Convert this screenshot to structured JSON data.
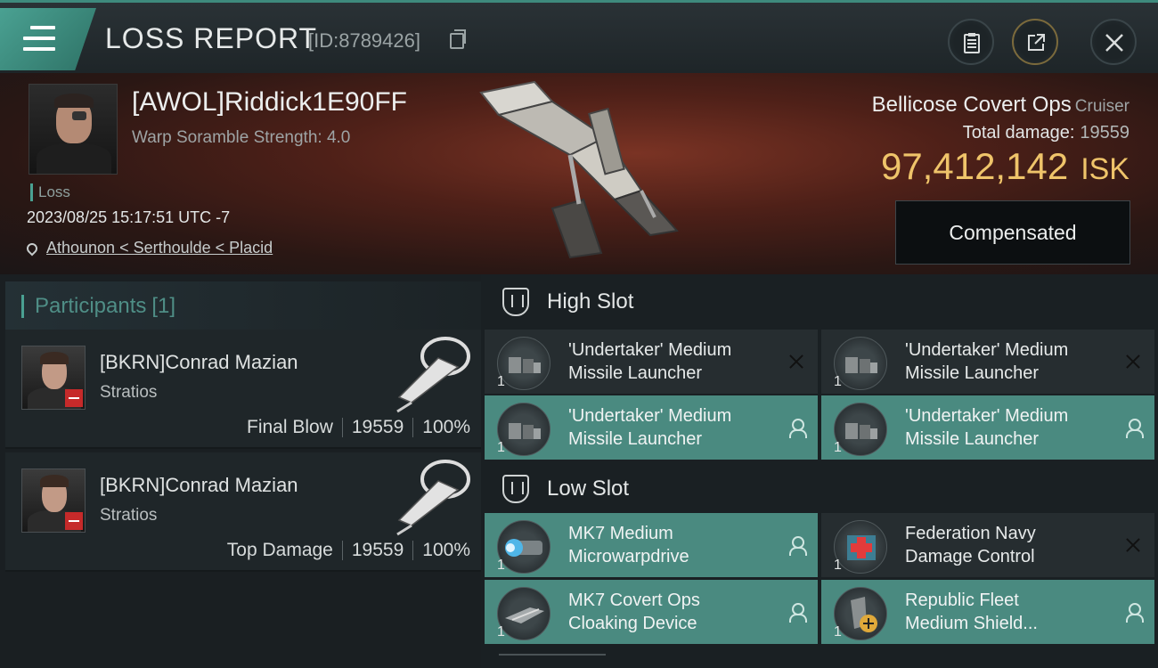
{
  "header": {
    "title": "LOSS REPORT",
    "report_id": "[ID:8789426]"
  },
  "victim": {
    "name": "[AWOL]Riddick1E90FF",
    "scramble": "Warp Soramble Strength: 4.0",
    "tag": "Loss",
    "datetime": "2023/08/25 15:17:51 UTC -7",
    "location": "Athounon < Serthoulde < Placid",
    "ship_name": "Bellicose Covert Ops",
    "ship_class": "Cruiser",
    "total_damage_label": "Total damage:",
    "total_damage": "19559",
    "isk_value": "97,412,142",
    "isk_unit": "ISK",
    "compensated_label": "Compensated"
  },
  "participants": {
    "label": "Participants",
    "count": "[1]",
    "items": [
      {
        "name": "[BKRN]Conrad Mazian",
        "ship": "Stratios",
        "role": "Final Blow",
        "damage": "19559",
        "percent": "100%"
      },
      {
        "name": "[BKRN]Conrad Mazian",
        "ship": "Stratios",
        "role": "Top Damage",
        "damage": "19559",
        "percent": "100%"
      }
    ]
  },
  "fitting": {
    "high_slot_label": "High Slot",
    "low_slot_label": "Low Slot",
    "high": [
      {
        "qty": "1",
        "line1": "'Undertaker' Medium",
        "line2": "Missile Launcher",
        "status": "destroyed"
      },
      {
        "qty": "1",
        "line1": "'Undertaker' Medium",
        "line2": "Missile Launcher",
        "status": "destroyed"
      },
      {
        "qty": "1",
        "line1": "'Undertaker' Medium",
        "line2": "Missile Launcher",
        "status": "dropped"
      },
      {
        "qty": "1",
        "line1": "'Undertaker' Medium",
        "line2": "Missile Launcher",
        "status": "dropped"
      }
    ],
    "low": [
      {
        "qty": "1",
        "line1": "MK7 Medium",
        "line2": "Microwarpdrive",
        "status": "dropped"
      },
      {
        "qty": "1",
        "line1": "Federation Navy",
        "line2": "Damage Control",
        "status": "destroyed"
      },
      {
        "qty": "1",
        "line1": "MK7 Covert Ops",
        "line2": "Cloaking Device",
        "status": "dropped"
      },
      {
        "qty": "1",
        "line1": "Republic Fleet",
        "line2": "Medium Shield...",
        "status": "dropped"
      }
    ]
  },
  "colors": {
    "accent": "#4aa192",
    "isk": "#efc46a",
    "dropped_bg": "#4a8a80"
  }
}
